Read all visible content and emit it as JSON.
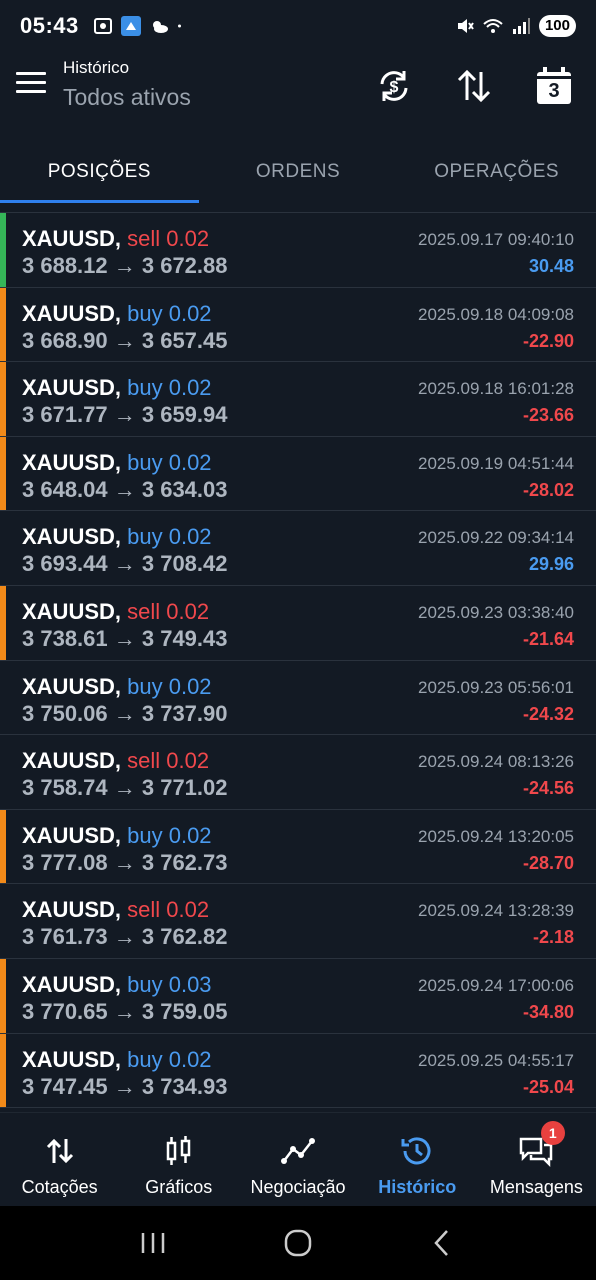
{
  "status_bar": {
    "time": "05:43",
    "battery": "100"
  },
  "header": {
    "title": "Histórico",
    "subtitle": "Todos ativos",
    "calendar_day": "3",
    "icons": [
      "currency-exchange-icon",
      "sort-icon",
      "calendar-icon"
    ]
  },
  "tabs": [
    {
      "label": "POSIÇÕES",
      "active": true
    },
    {
      "label": "ORDENS",
      "active": false
    },
    {
      "label": "OPERAÇÕES",
      "active": false
    }
  ],
  "colors": {
    "background": "#131a24",
    "sell": "#f0484c",
    "buy": "#4a9bf0",
    "accent": "#2f80ed",
    "edge_green": "#35b558",
    "edge_orange": "#f28a19"
  },
  "positions": [
    {
      "symbol": "XAUUSD,",
      "side": "sell 0.02",
      "type": "sell",
      "prices": "3 688.12 → 3 672.88",
      "datetime": "2025.09.17 09:40:10",
      "profit": "30.48",
      "edge": "green"
    },
    {
      "symbol": "XAUUSD,",
      "side": "buy 0.02",
      "type": "buy",
      "prices": "3 668.90 → 3 657.45",
      "datetime": "2025.09.18 04:09:08",
      "profit": "-22.90",
      "edge": "orange"
    },
    {
      "symbol": "XAUUSD,",
      "side": "buy 0.02",
      "type": "buy",
      "prices": "3 671.77 → 3 659.94",
      "datetime": "2025.09.18 16:01:28",
      "profit": "-23.66",
      "edge": "orange"
    },
    {
      "symbol": "XAUUSD,",
      "side": "buy 0.02",
      "type": "buy",
      "prices": "3 648.04 → 3 634.03",
      "datetime": "2025.09.19 04:51:44",
      "profit": "-28.02",
      "edge": "orange"
    },
    {
      "symbol": "XAUUSD,",
      "side": "buy 0.02",
      "type": "buy",
      "prices": "3 693.44 → 3 708.42",
      "datetime": "2025.09.22 09:34:14",
      "profit": "29.96",
      "edge": "none"
    },
    {
      "symbol": "XAUUSD,",
      "side": "sell 0.02",
      "type": "sell",
      "prices": "3 738.61 → 3 749.43",
      "datetime": "2025.09.23 03:38:40",
      "profit": "-21.64",
      "edge": "orange"
    },
    {
      "symbol": "XAUUSD,",
      "side": "buy 0.02",
      "type": "buy",
      "prices": "3 750.06 → 3 737.90",
      "datetime": "2025.09.23 05:56:01",
      "profit": "-24.32",
      "edge": "none"
    },
    {
      "symbol": "XAUUSD,",
      "side": "sell 0.02",
      "type": "sell",
      "prices": "3 758.74 → 3 771.02",
      "datetime": "2025.09.24 08:13:26",
      "profit": "-24.56",
      "edge": "none"
    },
    {
      "symbol": "XAUUSD,",
      "side": "buy 0.02",
      "type": "buy",
      "prices": "3 777.08 → 3 762.73",
      "datetime": "2025.09.24 13:20:05",
      "profit": "-28.70",
      "edge": "orange"
    },
    {
      "symbol": "XAUUSD,",
      "side": "sell 0.02",
      "type": "sell",
      "prices": "3 761.73 → 3 762.82",
      "datetime": "2025.09.24 13:28:39",
      "profit": "-2.18",
      "edge": "none"
    },
    {
      "symbol": "XAUUSD,",
      "side": "buy 0.03",
      "type": "buy",
      "prices": "3 770.65 → 3 759.05",
      "datetime": "2025.09.24 17:00:06",
      "profit": "-34.80",
      "edge": "orange"
    },
    {
      "symbol": "XAUUSD,",
      "side": "buy 0.02",
      "type": "buy",
      "prices": "3 747.45 → 3 734.93",
      "datetime": "2025.09.25 04:55:17",
      "profit": "-25.04",
      "edge": "orange"
    }
  ],
  "bottom_nav": [
    {
      "label": "Cotações",
      "icon": "quotes-icon",
      "active": false
    },
    {
      "label": "Gráficos",
      "icon": "charts-icon",
      "active": false
    },
    {
      "label": "Negociação",
      "icon": "trade-icon",
      "active": false
    },
    {
      "label": "Histórico",
      "icon": "history-icon",
      "active": true
    },
    {
      "label": "Mensagens",
      "icon": "messages-icon",
      "active": false,
      "badge": "1"
    }
  ]
}
